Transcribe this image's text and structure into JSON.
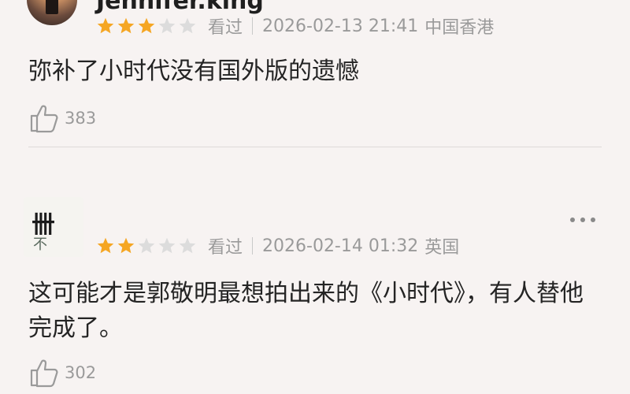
{
  "reviews": [
    {
      "username": "Jennifer.king",
      "rating": 3,
      "rating_max": 5,
      "status": "看过",
      "datetime": "2026-02-13 21:41",
      "location": "中国香港",
      "text": "弥补了小时代没有国外版的遗憾",
      "likes": "383"
    },
    {
      "username": "",
      "avatar_mark": "卌",
      "avatar_mark_sub": "不",
      "rating": 2,
      "rating_max": 5,
      "status": "看过",
      "datetime": "2026-02-14 01:32",
      "location": "英国",
      "text": "这可能才是郭敬明最想拍出来的《小时代》，有人替他完成了。",
      "likes": "302"
    }
  ],
  "colors": {
    "star_filled": "#f5a623",
    "star_empty": "#dcdcdc",
    "meta_text": "#9a9a9a",
    "background": "#f7f3f2"
  },
  "icons": {
    "more": "more-dots-icon",
    "like": "thumbs-up-icon",
    "star": "star-icon"
  }
}
